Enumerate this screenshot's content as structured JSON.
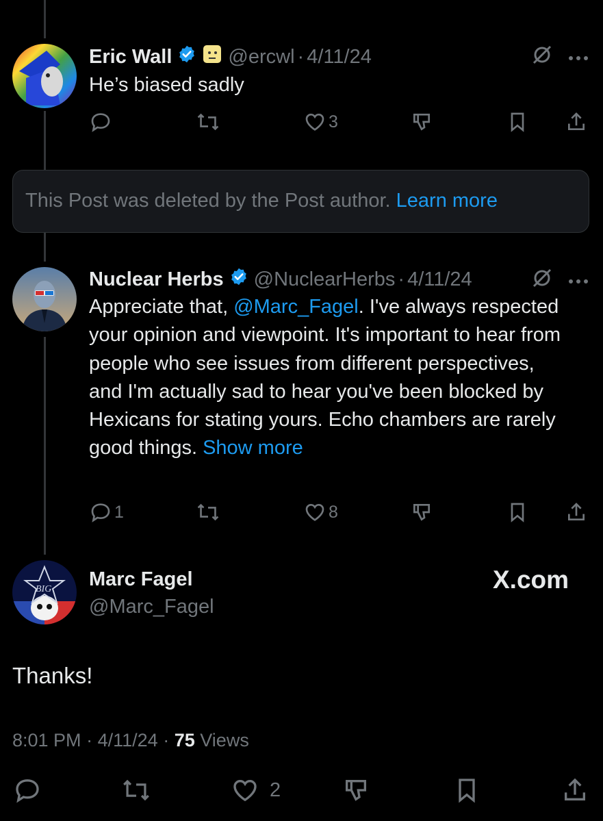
{
  "reply1": {
    "name": "Eric Wall",
    "handle": "@ercwl",
    "separator": "·",
    "date": "4/11/24",
    "text": "He’s biased sadly",
    "likes": "3"
  },
  "deleted": {
    "text": "This Post was deleted by the Post author.",
    "link": "Learn more"
  },
  "reply2": {
    "name": "Nuclear Herbs",
    "handle": "@NuclearHerbs",
    "separator": "·",
    "date": "4/11/24",
    "text_before": "Appreciate that, ",
    "mention": "@Marc_Fagel",
    "text_after": ". I've always respected your opinion and viewpoint. It's important to hear from people who see issues from different perspectives, and I'm actually sad to hear you've been blocked by Hexicans for stating yours. Echo chambers are rarely good things. ",
    "show_more": "Show more",
    "replies": "1",
    "likes": "8"
  },
  "main": {
    "name": "Marc Fagel",
    "handle": "@Marc_Fagel",
    "watermark": "X.com",
    "avatar_text": "BIG",
    "text": "Thanks!",
    "time": "8:01 PM",
    "separator": "·",
    "date": "4/11/24",
    "views_count": "75",
    "views_label": "Views",
    "likes": "2"
  },
  "colors": {
    "background": "#000000",
    "text": "#e7e9ea",
    "muted": "#71767b",
    "link": "#1d9bf0",
    "verified": "#1d9bf0"
  },
  "icons": [
    "reply-icon",
    "retweet-icon",
    "like-icon",
    "dislike-icon",
    "bookmark-icon",
    "share-icon",
    "grok-icon",
    "more-icon",
    "verified-badge-icon",
    "emoji-badge-icon"
  ]
}
